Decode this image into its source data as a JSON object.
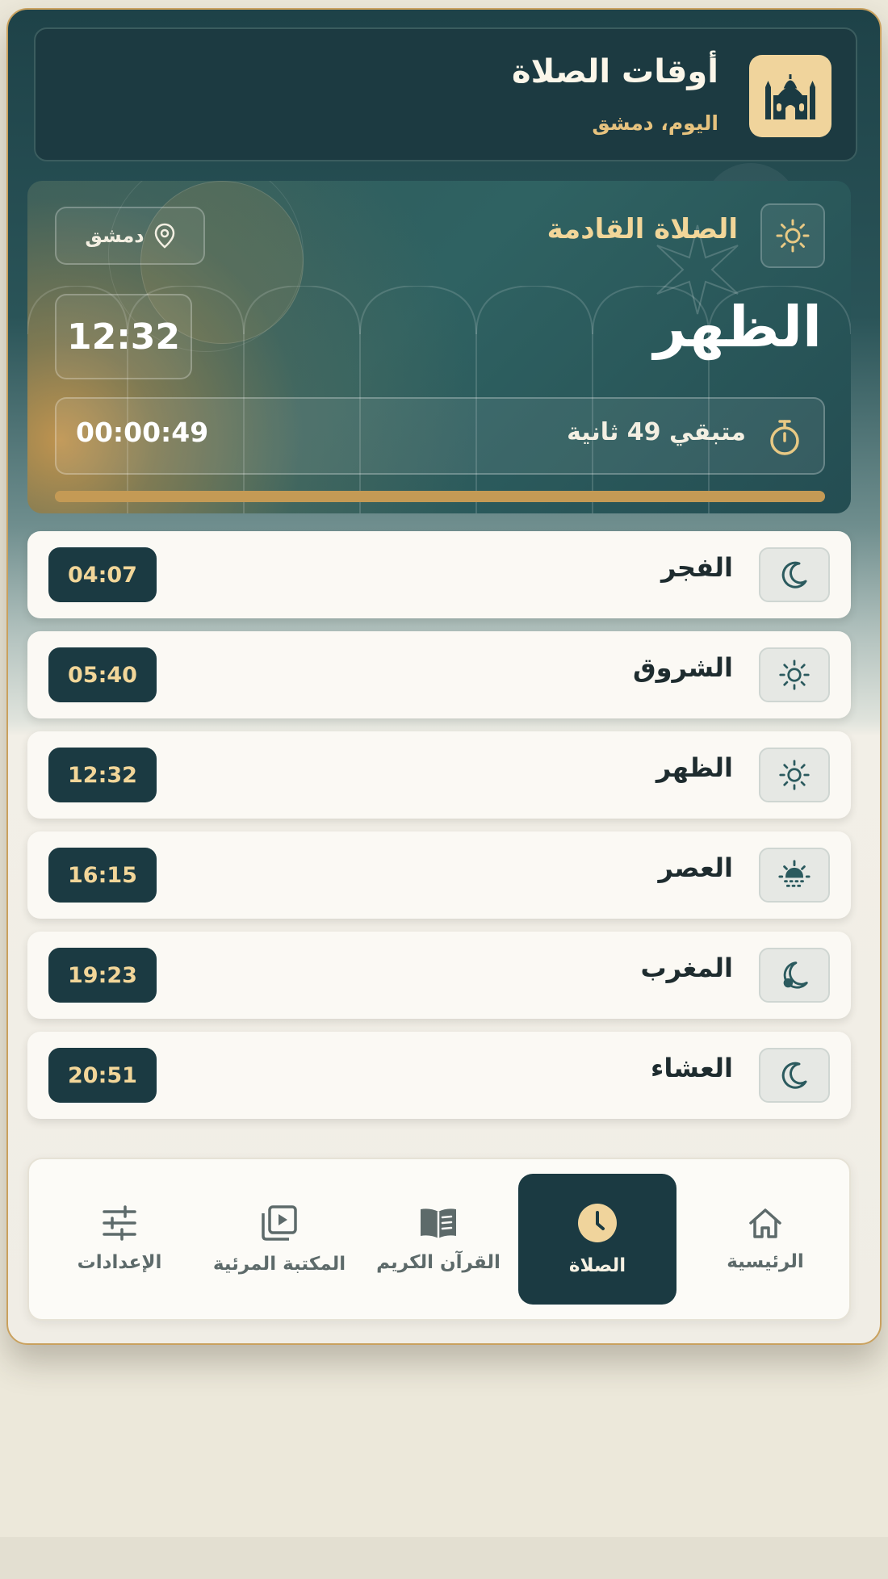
{
  "header": {
    "title": "أوقات الصلاة",
    "subtitle": "اليوم، دمشق",
    "logo_icon": "mosque-icon"
  },
  "next_prayer": {
    "label": "الصلاة القادمة",
    "icon": "sun-icon",
    "location": "دمشق",
    "name": "الظهر",
    "time": "12:32",
    "countdown_text": "متبقي 49 ثانية",
    "countdown_value": "00:00:49",
    "progress": 1.0
  },
  "prayers": [
    {
      "name": "الفجر",
      "time": "04:07",
      "icon": "crescent-moon-icon"
    },
    {
      "name": "الشروق",
      "time": "05:40",
      "icon": "sun-icon"
    },
    {
      "name": "الظهر",
      "time": "12:32",
      "icon": "sun-icon"
    },
    {
      "name": "العصر",
      "time": "16:15",
      "icon": "sun-haze-icon"
    },
    {
      "name": "المغرب",
      "time": "19:23",
      "icon": "sunset-moon-icon"
    },
    {
      "name": "العشاء",
      "time": "20:51",
      "icon": "crescent-moon-icon"
    }
  ],
  "nav": [
    {
      "label": "الرئيسية",
      "icon": "home-icon",
      "active": false
    },
    {
      "label": "الصلاة",
      "icon": "clock-icon",
      "active": true
    },
    {
      "label": "القرآن الكريم",
      "icon": "book-icon",
      "active": false
    },
    {
      "label": "المكتبة المرئية",
      "icon": "video-library-icon",
      "active": false
    },
    {
      "label": "الإعدادات",
      "icon": "sliders-icon",
      "active": false
    }
  ],
  "colors": {
    "primary": "#1b3a42",
    "gold": "#f2d699",
    "accent": "#c49a55",
    "background": "#ece8da"
  }
}
